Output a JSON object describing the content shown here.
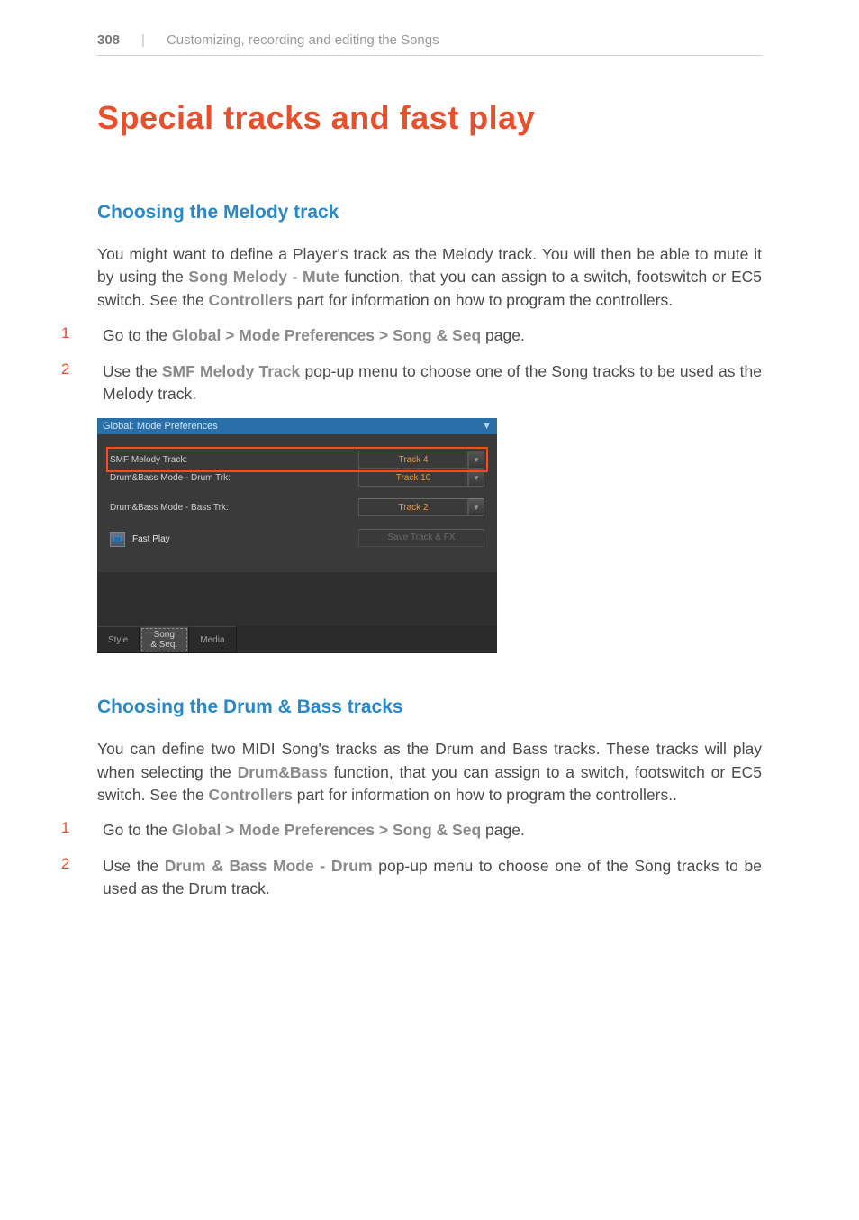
{
  "header": {
    "page_number": "308",
    "divider": "|",
    "chapter": "Customizing, recording and editing the Songs"
  },
  "title": "Special tracks and fast play",
  "section1": {
    "heading": "Choosing the Melody track",
    "para1_a": "You might want to define a Player's track as the Melody track. You will then be able to mute it by using the ",
    "para1_ref1": "Song Melody - Mute",
    "para1_b": " function, that you can assign to a switch, footswitch or EC5 switch. See the ",
    "para1_ref2": "Controllers",
    "para1_c": " part for information on how to program the controllers.",
    "step1_num": "1",
    "step1_a": "Go to the ",
    "step1_ref": "Global > Mode Preferences > Song & Seq",
    "step1_b": " page.",
    "step2_num": "2",
    "step2_a": "Use the ",
    "step2_ref": "SMF Melody Track",
    "step2_b": " pop-up menu to choose one of the Song tracks to be used as the Melody track."
  },
  "screenshot": {
    "title": "Global: Mode Preferences",
    "menu_icon": "▼",
    "row1_label": "SMF Melody Track:",
    "row1_value": "Track 4",
    "row2_label": "Drum&Bass Mode - Drum Trk:",
    "row2_value": "Track 10",
    "row3_label": "Drum&Bass Mode - Bass Trk:",
    "row3_value": "Track 2",
    "checkbox_label": "Fast Play",
    "save_button": "Save Track & FX",
    "tab1": "Style",
    "tab2": "Song\n& Seq.",
    "tab3": "Media",
    "dropdown_arrow": "▼"
  },
  "section2": {
    "heading": "Choosing the Drum & Bass tracks",
    "para1_a": "You can define two MIDI Song's tracks as the Drum and Bass tracks. These tracks will play when selecting the ",
    "para1_ref1": "Drum&Bass",
    "para1_b": " function, that you can assign to a switch, footswitch or EC5 switch. See the ",
    "para1_ref2": "Controllers",
    "para1_c": " part for information on how to program the controllers..",
    "step1_num": "1",
    "step1_a": "Go to the ",
    "step1_ref": "Global > Mode Preferences > Song & Seq",
    "step1_b": " page.",
    "step2_num": "2",
    "step2_a": "Use the ",
    "step2_ref": "Drum & Bass Mode - Drum",
    "step2_b": " pop-up menu to choose one of the Song tracks to be used as the Drum track."
  }
}
